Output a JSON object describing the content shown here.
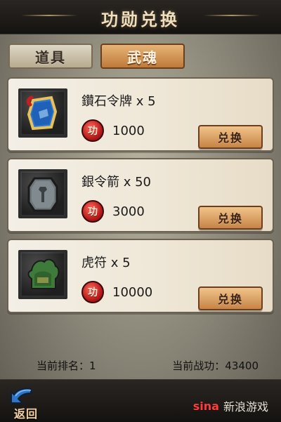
{
  "header": {
    "title": "功勋兑换"
  },
  "tabs": [
    {
      "label": "道具",
      "active": false
    },
    {
      "label": "武魂",
      "active": true
    }
  ],
  "items": [
    {
      "name": "鑽石令牌 x 5",
      "cost": "1000",
      "button_label": "兑换",
      "icon": "diamond-token-icon"
    },
    {
      "name": "銀令箭 x 50",
      "cost": "3000",
      "button_label": "兑换",
      "icon": "silver-token-arrow-icon"
    },
    {
      "name": "虎符 x 5",
      "cost": "10000",
      "button_label": "兑换",
      "icon": "tiger-tally-icon"
    }
  ],
  "merit_badge_text": "功",
  "footer": {
    "rank": "当前排名：1",
    "merit": "当前战功：43400"
  },
  "nav": {
    "back_label": "返回"
  },
  "watermark": {
    "logo": "sina",
    "text": "新浪游戏"
  }
}
